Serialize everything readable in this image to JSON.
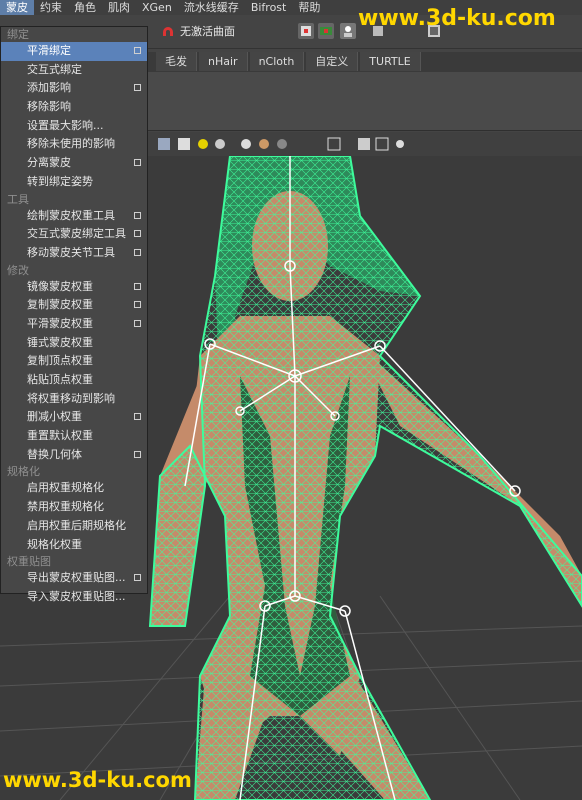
{
  "menubar": {
    "items": [
      "蒙皮",
      "约束",
      "角色",
      "肌肉",
      "XGen",
      "流水线缓存",
      "Bifrost",
      "帮助"
    ]
  },
  "toolbar": {
    "live_surface_label": "无激活曲面"
  },
  "shelf_tabs": [
    "毛发",
    "nHair",
    "nCloth",
    "自定义",
    "TURTLE"
  ],
  "skin_menu": {
    "sections": [
      {
        "title": "绑定",
        "items": [
          {
            "label": "平滑绑定",
            "option": true
          },
          {
            "label": "交互式绑定",
            "option": false
          },
          {
            "label": "添加影响",
            "option": true
          },
          {
            "label": "移除影响",
            "option": false
          },
          {
            "label": "设置最大影响...",
            "option": false
          },
          {
            "label": "移除未使用的影响",
            "option": false
          },
          {
            "label": "分离蒙皮",
            "option": true
          },
          {
            "label": "转到绑定姿势",
            "option": false
          }
        ]
      },
      {
        "title": "工具",
        "items": [
          {
            "label": "绘制蒙皮权重工具",
            "option": true
          },
          {
            "label": "交互式蒙皮绑定工具",
            "option": true
          },
          {
            "label": "移动蒙皮关节工具",
            "option": true
          }
        ]
      },
      {
        "title": "修改",
        "items": [
          {
            "label": "镜像蒙皮权重",
            "option": true
          },
          {
            "label": "复制蒙皮权重",
            "option": true
          },
          {
            "label": "平滑蒙皮权重",
            "option": true
          },
          {
            "label": "锤式蒙皮权重",
            "option": false
          },
          {
            "label": "复制顶点权重",
            "option": false
          },
          {
            "label": "粘贴顶点权重",
            "option": false
          },
          {
            "label": "将权重移动到影响",
            "option": false
          },
          {
            "label": "删减小权重",
            "option": true
          },
          {
            "label": "重置默认权重",
            "option": false
          },
          {
            "label": "替换几何体",
            "option": true
          }
        ]
      },
      {
        "title": "规格化",
        "items": [
          {
            "label": "启用权重规格化",
            "option": false
          },
          {
            "label": "禁用权重规格化",
            "option": false
          },
          {
            "label": "启用权重后期规格化",
            "option": false
          },
          {
            "label": "规格化权重",
            "option": false
          }
        ]
      },
      {
        "title": "权重贴图",
        "items": [
          {
            "label": "导出蒙皮权重贴图...",
            "option": true
          },
          {
            "label": "导入蒙皮权重贴图...",
            "option": false
          }
        ]
      }
    ]
  },
  "watermark": {
    "top": "www.3d-ku.com",
    "bottom": "www.3d-ku.com"
  },
  "colors": {
    "mesh_wire": "#3dfc9c",
    "skin_fill": "#c58b6a",
    "menu_highlight": "#5b82ba",
    "watermark": "#ffd700"
  }
}
